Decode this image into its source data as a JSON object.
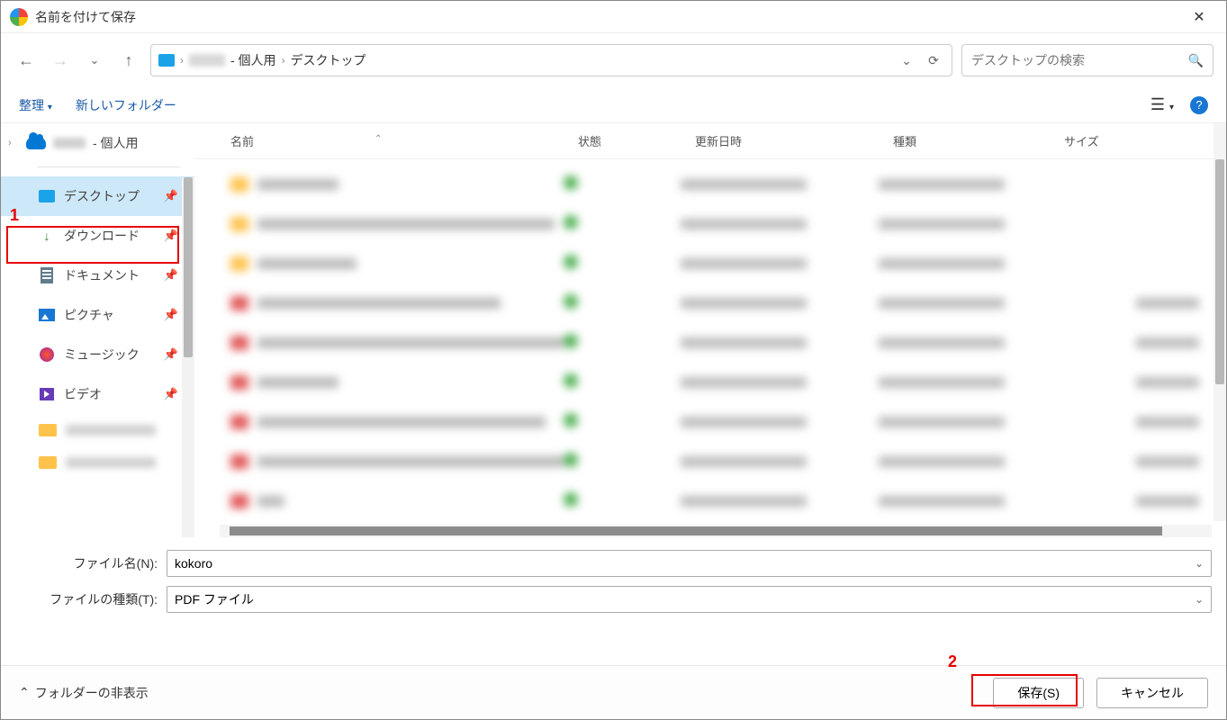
{
  "window": {
    "title": "名前を付けて保存"
  },
  "breadcrumb": {
    "suffix_personal": " - 個人用",
    "current": "デスクトップ"
  },
  "search": {
    "placeholder": "デスクトップの検索"
  },
  "toolbar": {
    "organize": "整理",
    "new_folder": "新しいフォルダー"
  },
  "tree": {
    "personal_suffix": " - 個人用",
    "items": {
      "desktop": "デスクトップ",
      "downloads": "ダウンロード",
      "documents": "ドキュメント",
      "pictures": "ピクチャ",
      "music": "ミュージック",
      "videos": "ビデオ"
    }
  },
  "columns": {
    "name": "名前",
    "status": "状態",
    "date": "更新日時",
    "type": "種類",
    "size": "サイズ"
  },
  "form": {
    "filename_label": "ファイル名(N):",
    "filename_value": "kokoro",
    "filetype_label": "ファイルの種類(T):",
    "filetype_value": "PDF ファイル"
  },
  "footer": {
    "toggle": "フォルダーの非表示",
    "save": "保存(S)",
    "cancel": "キャンセル"
  },
  "annotations": {
    "one": "1",
    "two": "2"
  }
}
